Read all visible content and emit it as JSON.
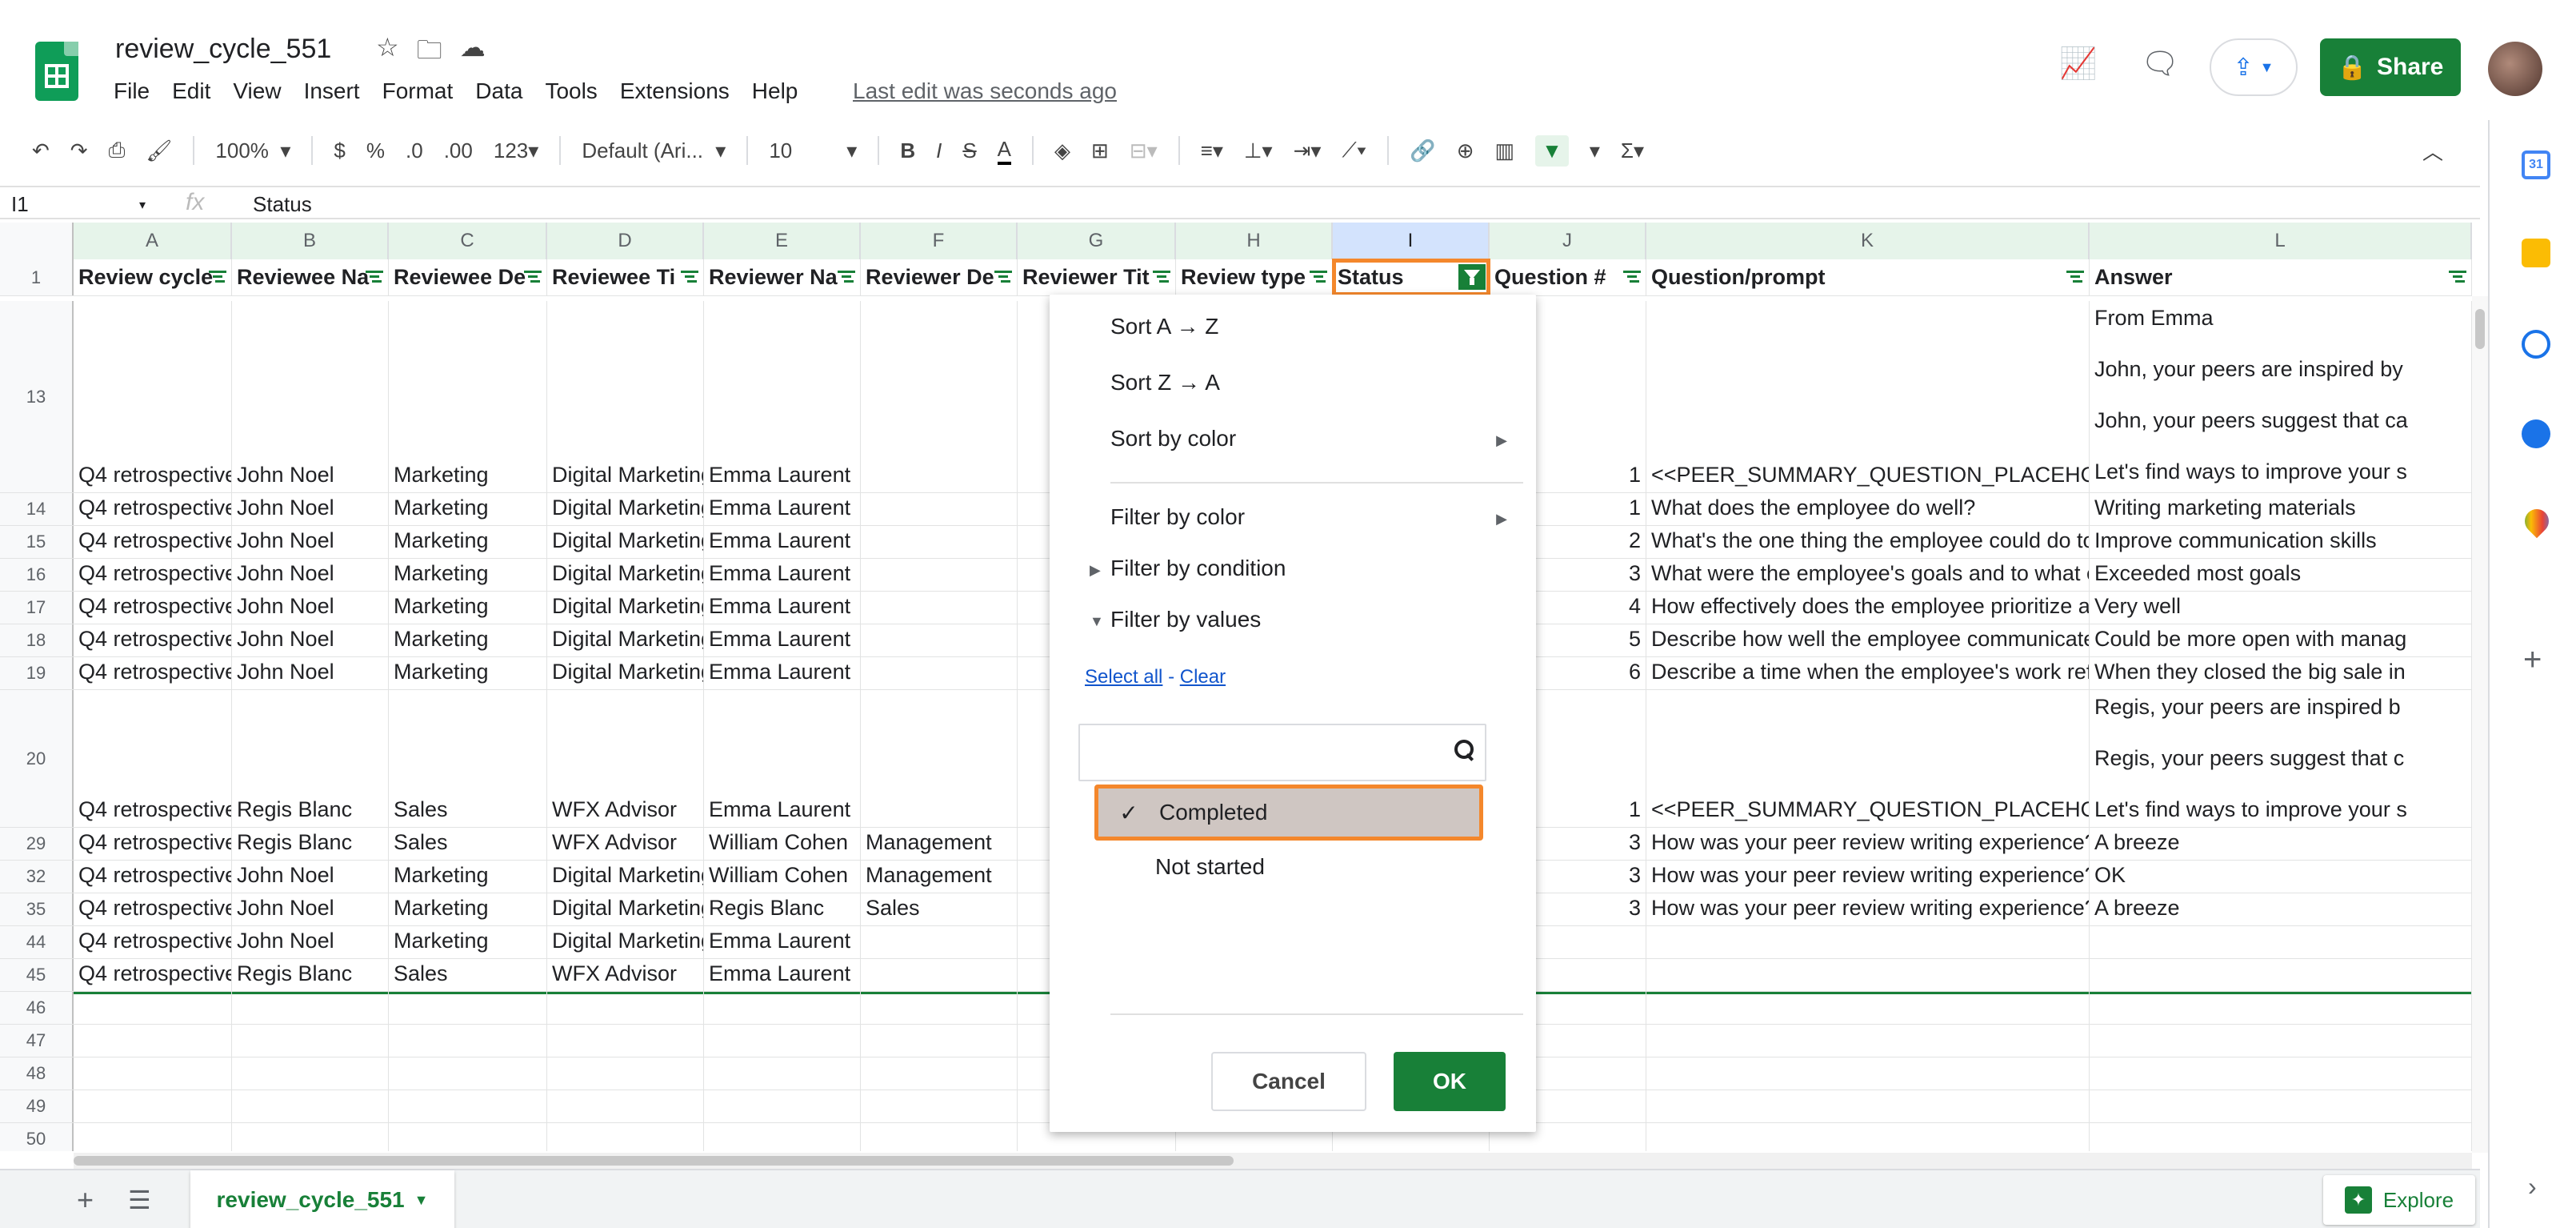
{
  "doc": {
    "title": "review_cycle_551",
    "menu": [
      "File",
      "Edit",
      "View",
      "Insert",
      "Format",
      "Data",
      "Tools",
      "Extensions",
      "Help"
    ],
    "last_edit": "Last edit was seconds ago",
    "share_label": "Share"
  },
  "toolbar": {
    "zoom": "100%",
    "currency": "$",
    "percent": "%",
    "dec_minus": ".0",
    "dec_plus": ".00",
    "format_num": "123",
    "font": "Default (Ari...",
    "font_size": "10",
    "bold": "B",
    "italic": "I",
    "strike": "S",
    "text_color": "A",
    "sigma": "Σ"
  },
  "formula_bar": {
    "cell_ref": "I1",
    "fx": "fx",
    "value": "Status"
  },
  "columns": [
    "A",
    "B",
    "C",
    "D",
    "E",
    "F",
    "G",
    "H",
    "I",
    "J",
    "K",
    "L"
  ],
  "headers": [
    "Review cycle",
    "Reviewee Na",
    "Reviewee De",
    "Reviewee Ti",
    "Reviewer Na",
    "Reviewer De",
    "Reviewer Tit",
    "Review type",
    "Status",
    "Question #",
    "Question/prompt",
    "Answer"
  ],
  "rows": [
    {
      "num": "13",
      "cells": [
        "Q4 retrospective",
        "John Noel",
        "Marketing",
        "Digital Marketing",
        "Emma Laurent",
        "",
        "",
        "",
        "",
        "1",
        "<<PEER_SUMMARY_QUESTION_PLACEHOLDER",
        "Let's find ways to improve your s"
      ],
      "answer_lines": [
        "From Emma",
        "John, your peers are inspired by",
        "John, your peers suggest that ca"
      ]
    },
    {
      "num": "14",
      "cells": [
        "Q4 retrospective",
        "John Noel",
        "Marketing",
        "Digital Marketing",
        "Emma Laurent",
        "",
        "",
        "",
        "",
        "1",
        "What does the employee do well?",
        "Writing marketing materials"
      ]
    },
    {
      "num": "15",
      "cells": [
        "Q4 retrospective",
        "John Noel",
        "Marketing",
        "Digital Marketing",
        "Emma Laurent",
        "",
        "",
        "",
        "",
        "2",
        "What's the one thing the employee could do to i",
        "Improve communication skills"
      ]
    },
    {
      "num": "16",
      "cells": [
        "Q4 retrospective",
        "John Noel",
        "Marketing",
        "Digital Marketing",
        "Emma Laurent",
        "",
        "",
        "",
        "",
        "3",
        "What were the employee's goals and to what ex",
        "Exceeded most goals"
      ]
    },
    {
      "num": "17",
      "cells": [
        "Q4 retrospective",
        "John Noel",
        "Marketing",
        "Digital Marketing",
        "Emma Laurent",
        "",
        "",
        "",
        "",
        "4",
        "How effectively does the employee prioritize an",
        "Very well"
      ]
    },
    {
      "num": "18",
      "cells": [
        "Q4 retrospective",
        "John Noel",
        "Marketing",
        "Digital Marketing",
        "Emma Laurent",
        "",
        "",
        "",
        "",
        "5",
        "Describe how well the employee communicates",
        "Could be more open with manag"
      ]
    },
    {
      "num": "19",
      "cells": [
        "Q4 retrospective",
        "John Noel",
        "Marketing",
        "Digital Marketing",
        "Emma Laurent",
        "",
        "",
        "",
        "",
        "6",
        "Describe a time when the employee's work refle",
        "When they closed the big sale in"
      ]
    },
    {
      "num": "20",
      "cells": [
        "Q4 retrospective",
        "Regis Blanc",
        "Sales",
        "WFX Advisor",
        "Emma Laurent",
        "",
        "",
        "",
        "",
        "1",
        "<<PEER_SUMMARY_QUESTION_PLACEHOLDER",
        "Let's find ways to improve your s"
      ],
      "answer_lines": [
        "Regis, your peers are inspired b",
        "Regis, your peers suggest that c"
      ]
    },
    {
      "num": "29",
      "cells": [
        "Q4 retrospective",
        "Regis Blanc",
        "Sales",
        "WFX Advisor",
        "William Cohen",
        "Management",
        "",
        "",
        "",
        "3",
        "How was your peer review writing experience?",
        "A breeze"
      ]
    },
    {
      "num": "32",
      "cells": [
        "Q4 retrospective",
        "John Noel",
        "Marketing",
        "Digital Marketing",
        "William Cohen",
        "Management",
        "",
        "",
        "",
        "3",
        "How was your peer review writing experience?",
        "OK"
      ]
    },
    {
      "num": "35",
      "cells": [
        "Q4 retrospective",
        "John Noel",
        "Marketing",
        "Digital Marketing",
        "Regis Blanc",
        "Sales",
        "",
        "",
        "",
        "3",
        "How was your peer review writing experience?",
        "A breeze"
      ]
    },
    {
      "num": "44",
      "cells": [
        "Q4 retrospective",
        "John Noel",
        "Marketing",
        "Digital Marketing",
        "Emma Laurent",
        "",
        "",
        "",
        "",
        "",
        "",
        ""
      ]
    },
    {
      "num": "45",
      "cells": [
        "Q4 retrospective",
        "Regis Blanc",
        "Sales",
        "WFX Advisor",
        "Emma Laurent",
        "",
        "",
        "",
        "",
        "",
        "",
        ""
      ]
    },
    {
      "num": "46",
      "cells": [
        "",
        "",
        "",
        "",
        "",
        "",
        "",
        "",
        "",
        "",
        "",
        ""
      ]
    },
    {
      "num": "47",
      "cells": [
        "",
        "",
        "",
        "",
        "",
        "",
        "",
        "",
        "",
        "",
        "",
        ""
      ]
    },
    {
      "num": "48",
      "cells": [
        "",
        "",
        "",
        "",
        "",
        "",
        "",
        "",
        "",
        "",
        "",
        ""
      ]
    },
    {
      "num": "49",
      "cells": [
        "",
        "",
        "",
        "",
        "",
        "",
        "",
        "",
        "",
        "",
        "",
        ""
      ]
    },
    {
      "num": "50",
      "cells": [
        "",
        "",
        "",
        "",
        "",
        "",
        "",
        "",
        "",
        "",
        "",
        ""
      ]
    }
  ],
  "filter_menu": {
    "sort_az": "Sort A → Z",
    "sort_za": "Sort Z → A",
    "sort_color": "Sort by color",
    "filter_color": "Filter by color",
    "filter_condition": "Filter by condition",
    "filter_values": "Filter by values",
    "select_all": "Select all",
    "dash": "-",
    "clear": "Clear",
    "search_placeholder": "",
    "options": [
      {
        "label": "Completed",
        "checked": true
      },
      {
        "label": "Not started",
        "checked": false
      }
    ],
    "cancel": "Cancel",
    "ok": "OK"
  },
  "sheet": {
    "tab_name": "review_cycle_551",
    "explore": "Explore"
  },
  "colors": {
    "green": "#188038",
    "highlight": "#f4872c"
  }
}
